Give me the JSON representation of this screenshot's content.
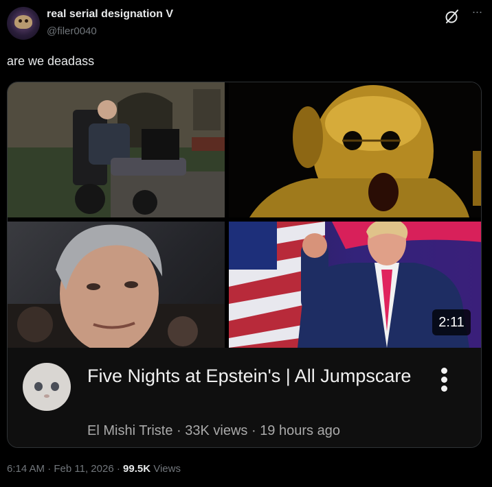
{
  "author": {
    "display_name": "real serial designation V",
    "handle": "@filer0040",
    "avatar_icon": "user-avatar"
  },
  "header_icons": [
    "grok-icon",
    "more-horizontal-icon"
  ],
  "tweet_text": "are we deadass",
  "embed": {
    "thumbnail_icon": "video-thumbnail",
    "duration": "2:11",
    "channel_avatar_icon": "crying-cat-avatar",
    "title": "Five Nights at Epstein's | All Jumpscare",
    "channel": "El Mishi Triste",
    "views": "33K views",
    "age": "19 hours ago",
    "menu_icon": "more-vertical-icon"
  },
  "footer": {
    "time": "6:14 AM",
    "date": "Feb 11, 2026",
    "views_count": "99.5K",
    "views_label": "Views"
  },
  "colors": {
    "background": "#000000",
    "text": "#e7e9ea",
    "muted": "#71767b",
    "card_bg": "#0f0f0f",
    "border": "#2f3336"
  }
}
